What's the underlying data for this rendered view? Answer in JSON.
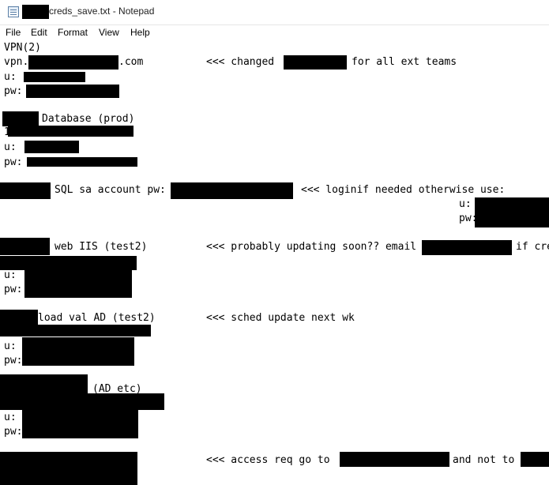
{
  "window": {
    "title": "creds_save.txt - Notepad"
  },
  "menu": [
    "File",
    "Edit",
    "Format",
    "View",
    "Help"
  ],
  "document": {
    "lines": [
      "VPN(2)",
      "vpn.",
      ".com",
      "<<< changed",
      "for all ext teams",
      "u:",
      "pw:",
      "Database (prod)",
      "1",
      "u:",
      "pw:",
      "SQL sa account pw:",
      "<<< loginif needed otherwise use:",
      "u:",
      "pw:",
      "web IIS (test2)",
      "<<< probably updating soon?? email",
      "if cre",
      "u:",
      "pw:",
      "load val AD (test2)",
      "<<< sched update next wk",
      "u:",
      "pw:",
      "(AD etc)",
      "u:",
      "pw:",
      "<<< access req go to",
      "and not to"
    ]
  }
}
